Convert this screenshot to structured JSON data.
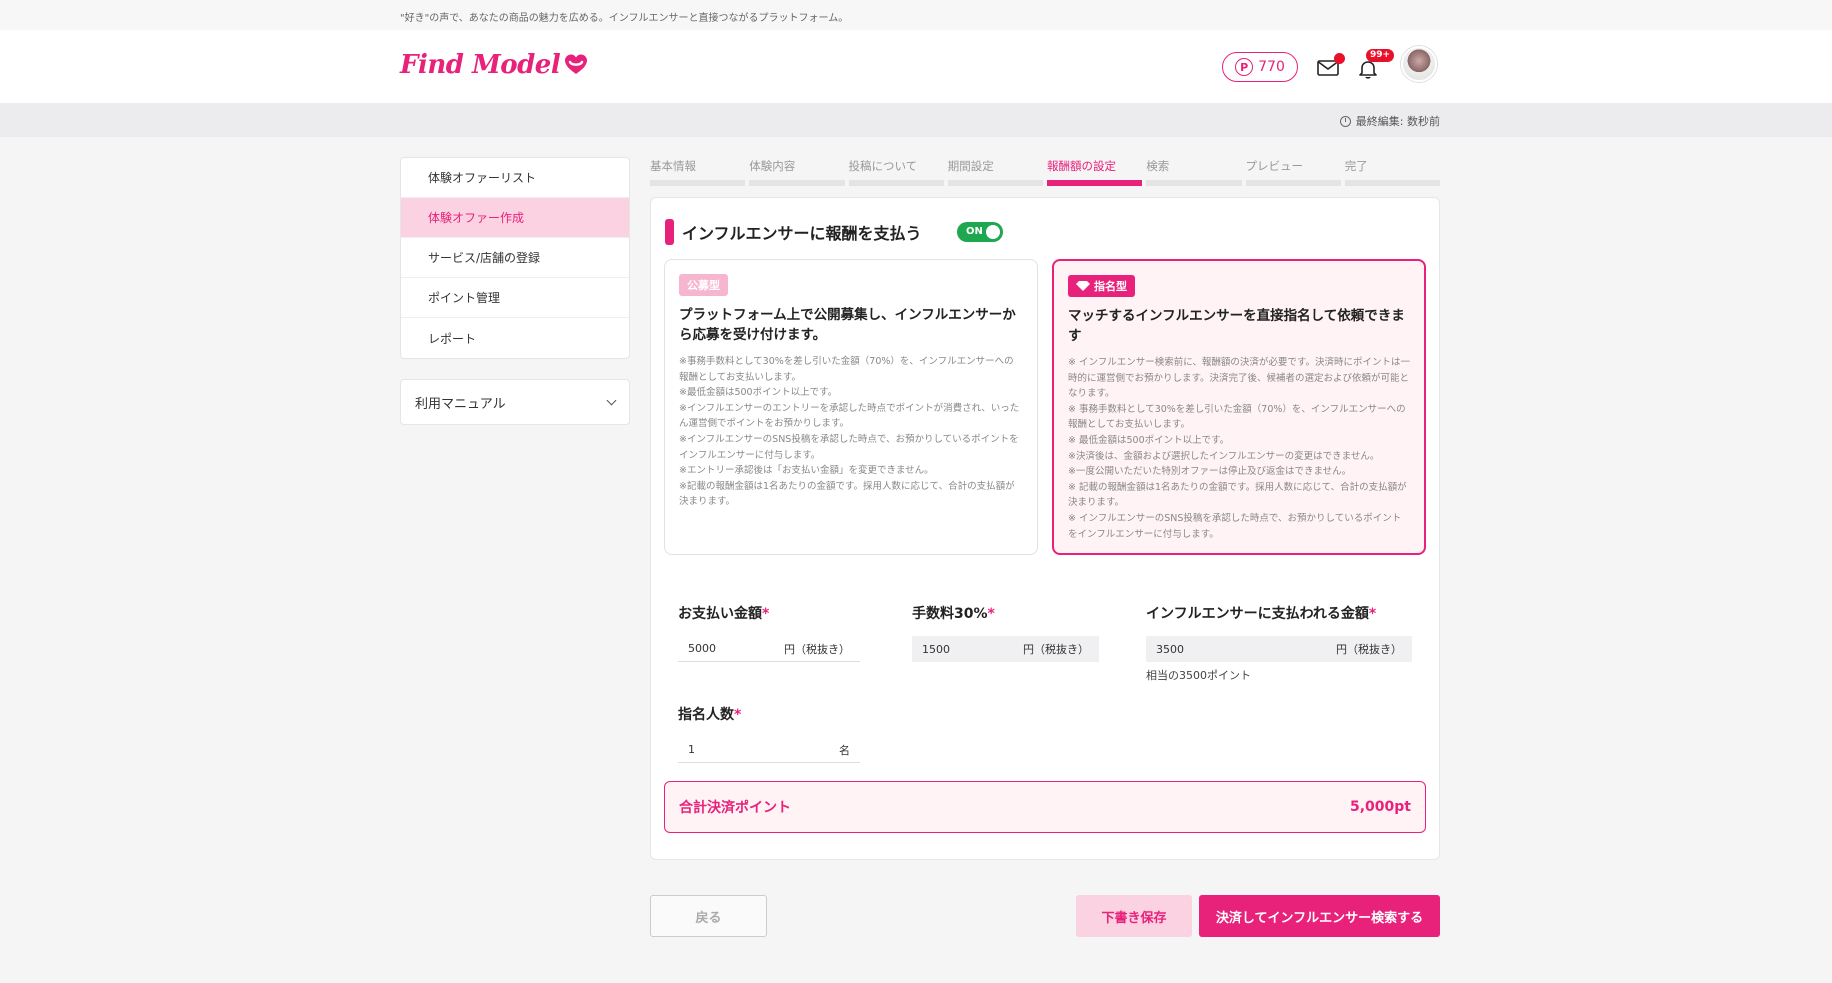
{
  "tagline": "\"好き\"の声で、あなたの商品の魅力を広める。インフルエンサーと直接つながるプラットフォーム。",
  "header": {
    "logo_text": "Find Model",
    "points_symbol": "P",
    "points": "770",
    "notification_badge": "99+"
  },
  "last_edited": "最終編集: 数秒前",
  "sidebar": {
    "items": [
      {
        "label": "体験オファーリスト"
      },
      {
        "label": "体験オファー作成"
      },
      {
        "label": "サービス/店舗の登録"
      },
      {
        "label": "ポイント管理"
      },
      {
        "label": "レポート"
      }
    ],
    "manual_label": "利用マニュアル"
  },
  "steps": [
    {
      "label": "基本情報"
    },
    {
      "label": "体験内容"
    },
    {
      "label": "投稿について"
    },
    {
      "label": "期間設定"
    },
    {
      "label": "報酬額の設定"
    },
    {
      "label": "検索"
    },
    {
      "label": "プレビュー"
    },
    {
      "label": "完了"
    }
  ],
  "section": {
    "title": "インフルエンサーに報酬を支払う",
    "toggle_label": "ON"
  },
  "cards": {
    "open": {
      "tag": "公募型",
      "title": "プラットフォーム上で公開募集し、インフルエンサーから応募を受け付けます。",
      "notes": [
        "※事務手数料として30%を差し引いた金額（70%）を、インフルエンサーへの報酬としてお支払いします。",
        "※最低金額は500ポイント以上です。",
        "※インフルエンサーのエントリーを承認した時点でポイントが消費され、いったん運営側でポイントをお預かりします。",
        "※インフルエンサーのSNS投稿を承認した時点で、お預かりしているポイントをインフルエンサーに付与します。",
        "※エントリー承認後は「お支払い金額」を変更できません。",
        "※記載の報酬金額は1名あたりの金額です。採用人数に応じて、合計の支払額が決まります。"
      ]
    },
    "nominated": {
      "tag": "指名型",
      "title": "マッチするインフルエンサーを直接指名して依頼できます",
      "notes": [
        "※ インフルエンサー検索前に、報酬額の決済が必要です。決済時にポイントは一時的に運営側でお預かりします。決済完了後、候補者の選定および依頼が可能となります。",
        "※ 事務手数料として30%を差し引いた金額（70%）を、インフルエンサーへの報酬としてお支払いします。",
        "※ 最低金額は500ポイント以上です。",
        "※決済後は、金額および選択したインフルエンサーの変更はできません。",
        "※一度公開いただいた特別オファーは停止及び返金はできません。",
        "※ 記載の報酬金額は1名あたりの金額です。採用人数に応じて、合計の支払額が決まります。",
        "※ インフルエンサーのSNS投稿を承認した時点で、お預かりしているポイントをインフルエンサーに付与します。"
      ]
    }
  },
  "form": {
    "payment": {
      "label": "お支払い金額",
      "required": "*",
      "value": "5000",
      "unit": "円（税抜き）"
    },
    "fee": {
      "label": "手数料30%",
      "required": "*",
      "value": "1500",
      "unit": "円（税抜き）"
    },
    "influencer_amount": {
      "label": "インフルエンサーに支払われる金額",
      "required": "*",
      "value": "3500",
      "unit": "円（税抜き）",
      "hint": "相当の3500ポイント"
    },
    "count": {
      "label": "指名人数",
      "required": "*",
      "value": "1",
      "unit": "名"
    }
  },
  "total": {
    "label": "合計決済ポイント",
    "value": "5,000pt"
  },
  "buttons": {
    "back": "戻る",
    "draft": "下書き保存",
    "pay": "決済してインフルエンサー検索する"
  },
  "colors": {
    "brand": "#e8217a",
    "toggle_on": "#1fa750",
    "badge": "#e8102a"
  }
}
